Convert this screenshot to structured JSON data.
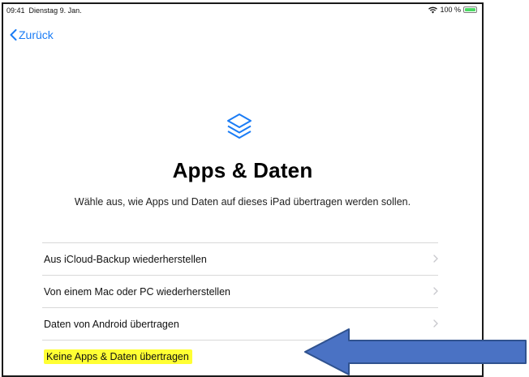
{
  "status_bar": {
    "time": "09:41",
    "date": "Dienstag 9. Jan.",
    "battery_text": "100 %",
    "battery_level": 1.0,
    "wifi_icon": "wifi-icon"
  },
  "nav": {
    "back_label": "Zurück"
  },
  "hero": {
    "icon": "layers-icon",
    "title": "Apps & Daten",
    "subtitle": "Wähle aus, wie Apps und Daten auf dieses iPad übertragen werden sollen."
  },
  "options": [
    {
      "label": "Aus iCloud-Backup wiederherstellen",
      "chevron": true
    },
    {
      "label": "Von einem Mac oder PC wiederherstellen",
      "chevron": true
    },
    {
      "label": "Daten von Android übertragen",
      "chevron": true
    },
    {
      "label": "Keine Apps & Daten übertragen",
      "chevron": false,
      "highlighted": true
    }
  ],
  "colors": {
    "accent": "#1a7cf5",
    "highlight": "#ffff33",
    "arrow_fill": "#4a72c4",
    "arrow_stroke": "#2f528f",
    "battery": "#4cd964"
  }
}
